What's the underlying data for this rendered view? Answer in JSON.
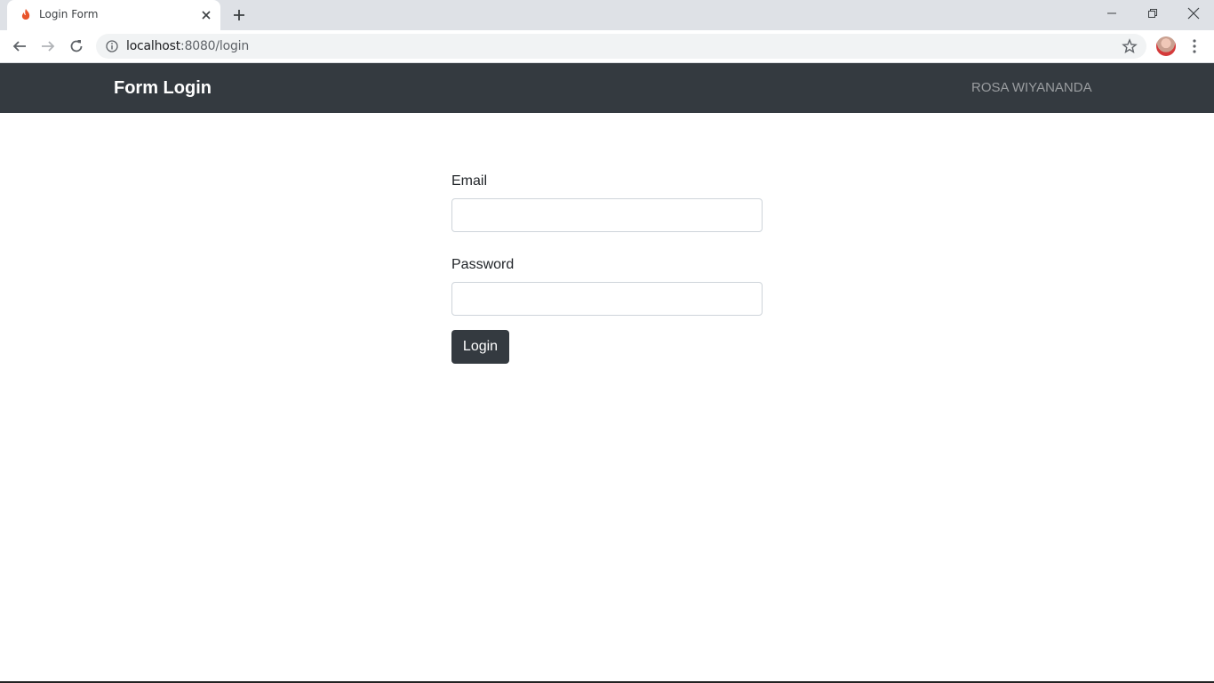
{
  "browser": {
    "tab_title": "Login Form",
    "url_host": "localhost",
    "url_rest": ":8080/login"
  },
  "navbar": {
    "brand": "Form Login",
    "user": "ROSA WIYANANDA"
  },
  "form": {
    "email_label": "Email",
    "email_value": "",
    "password_label": "Password",
    "password_value": "",
    "login_label": "Login"
  },
  "colors": {
    "navbar_bg": "#343a40",
    "button_bg": "#343a40",
    "input_border": "#ced4da"
  }
}
